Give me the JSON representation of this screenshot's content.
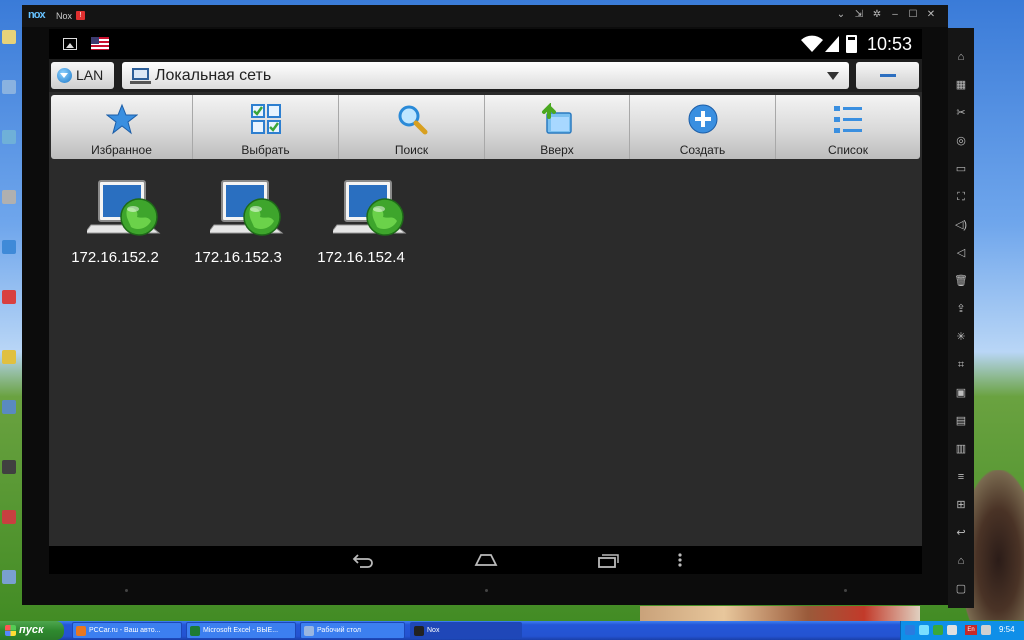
{
  "window": {
    "title": "Nox",
    "logo": "nox",
    "badge": "!"
  },
  "window_controls": [
    {
      "name": "collapse-icon",
      "glyph": "⌄"
    },
    {
      "name": "pin-icon",
      "glyph": "⇲"
    },
    {
      "name": "gear-icon",
      "glyph": "✲"
    },
    {
      "name": "minimize-icon",
      "glyph": "–"
    },
    {
      "name": "maximize-icon",
      "glyph": "☐"
    },
    {
      "name": "close-icon",
      "glyph": "✕"
    }
  ],
  "statusbar": {
    "time": "10:53",
    "wifi_glyph": "◔"
  },
  "addressbar": {
    "lan_label": "LAN",
    "path": "Локальная сеть"
  },
  "toolbar": {
    "buttons": [
      {
        "name": "favorites",
        "label": "Избранное",
        "icon": "star-icon"
      },
      {
        "name": "select",
        "label": "Выбрать",
        "icon": "select-grid-icon"
      },
      {
        "name": "search",
        "label": "Поиск",
        "icon": "search-icon"
      },
      {
        "name": "up",
        "label": "Вверх",
        "icon": "folder-up-icon"
      },
      {
        "name": "create",
        "label": "Создать",
        "icon": "plus-icon"
      },
      {
        "name": "list",
        "label": "Список",
        "icon": "list-icon"
      }
    ]
  },
  "files": [
    {
      "label": "172.16.152.2"
    },
    {
      "label": "172.16.152.3"
    },
    {
      "label": "172.16.152.4"
    }
  ],
  "navbar": {
    "back": "back-icon",
    "home": "home-icon",
    "recents": "recents-icon",
    "menu": "more-icon"
  },
  "side_tools": [
    "android-icon",
    "keyboard-icon",
    "scissors-icon",
    "location-icon",
    "screen-icon",
    "fullscreen-icon",
    "volume-up-icon",
    "volume-down-icon",
    "trash-icon",
    "install-apk-icon",
    "shake-icon",
    "screenshot-icon",
    "video-icon",
    "multi-window-icon",
    "macro-icon",
    "menu-icon",
    "add-icon",
    "back-icon",
    "home-icon",
    "recents-icon"
  ],
  "taskbar": {
    "start_label": "пуск",
    "tasks": [
      {
        "label": "PCCar.ru - Ваш авто...",
        "color": "#e87722"
      },
      {
        "label": "Microsoft Excel - ВЫЕ...",
        "color": "#1e7b34"
      },
      {
        "label": "Рабочий стол",
        "color": "#9ab6e0"
      },
      {
        "label": "Nox",
        "color": "#222222"
      }
    ],
    "tray_lang": "En",
    "time": "9:54"
  }
}
